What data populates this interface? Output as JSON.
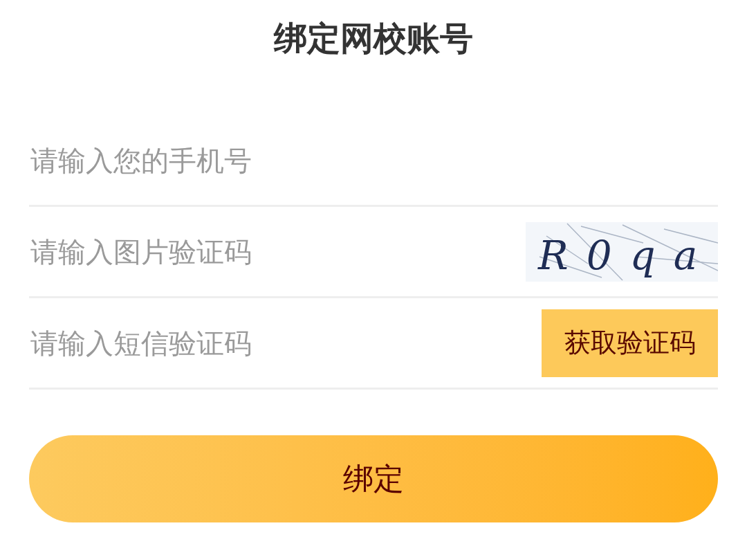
{
  "title": "绑定网校账号",
  "fields": [
    {
      "kind": "text",
      "placeholder": "请输入您的手机号"
    },
    {
      "kind": "captcha",
      "placeholder": "请输入图片验证码",
      "captcha": "R0qa"
    },
    {
      "kind": "sms",
      "placeholder": "请输入短信验证码",
      "button": "获取验证码"
    }
  ],
  "submit": "绑定"
}
